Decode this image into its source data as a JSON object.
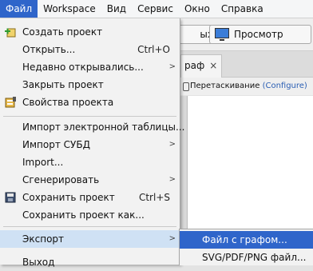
{
  "menubar": {
    "items": [
      "Файл",
      "Workspace",
      "Вид",
      "Сервис",
      "Окно",
      "Справка"
    ],
    "active_index": 0
  },
  "background": {
    "toolbar_left_label": "ых",
    "toolbar_preview_label": "Просмотр",
    "tab_label": "раф",
    "tab_close": "×",
    "drag_label": "Перетаскивание",
    "configure_link": "(Configure)"
  },
  "file_menu": {
    "new_project": "Создать проект",
    "open": "Открыть...",
    "open_shortcut": "Ctrl+O",
    "recent": "Недавно открывались...",
    "close_project": "Закрыть проект",
    "project_properties": "Свойства проекта",
    "import_spreadsheet": "Импорт электронной таблицы...",
    "import_dbms": "Импорт СУБД",
    "import": "Import...",
    "generate": "Сгенерировать",
    "save_project": "Сохранить проект",
    "save_shortcut": "Ctrl+S",
    "save_project_as": "Сохранить проект как...",
    "export": "Экспорт",
    "exit": "Выход"
  },
  "export_submenu": {
    "graph_file": "Файл с графом...",
    "svg_pdf_png": "SVG/PDF/PNG файл..."
  },
  "colors": {
    "selection": "#2f65ca",
    "hover": "#cfe1f4",
    "link": "#2b5fb4"
  }
}
